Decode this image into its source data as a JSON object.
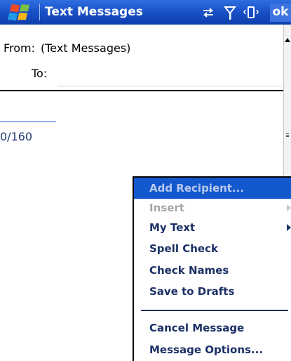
{
  "window": {
    "title": "Text Messages",
    "ok_label": "ok"
  },
  "header": {
    "from_label": "From:",
    "from_value": "(Text Messages)",
    "to_label": "To:"
  },
  "body": {
    "char_counter": "0/160"
  },
  "menu": {
    "items": [
      {
        "label": "Add Recipient...",
        "state": "selected"
      },
      {
        "label": "Insert",
        "state": "disabled",
        "has_submenu": true
      },
      {
        "label": "My Text",
        "state": "enabled",
        "has_submenu": true
      },
      {
        "label": "Spell Check",
        "state": "enabled"
      },
      {
        "label": "Check Names",
        "state": "enabled"
      },
      {
        "label": "Save to Drafts",
        "state": "enabled"
      },
      {
        "label": "Cancel Message",
        "state": "enabled"
      },
      {
        "label": "Message Options...",
        "state": "enabled"
      }
    ]
  },
  "icons": {
    "start": "windows-logo-icon",
    "connectivity": "connectivity-icon",
    "signal": "signal-strength-icon",
    "vibrate": "vibrate-icon"
  },
  "colors": {
    "title_bar": "#1a52c8",
    "menu_highlight": "#1458ce",
    "menu_text": "#1b3066",
    "disabled": "#a7a7a7"
  }
}
